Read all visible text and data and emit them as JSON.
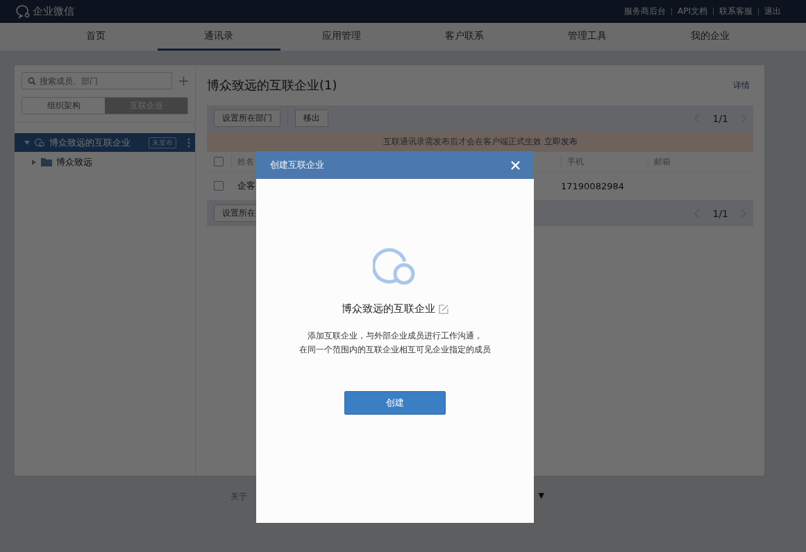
{
  "topbar": {
    "logo": "企业微信",
    "links": [
      "服务商后台",
      "API文档",
      "联系客服",
      "退出"
    ]
  },
  "nav": [
    {
      "label": "首页",
      "selected": false
    },
    {
      "label": "通讯录",
      "selected": true
    },
    {
      "label": "应用管理",
      "selected": false
    },
    {
      "label": "客户联系",
      "selected": false
    },
    {
      "label": "管理工具",
      "selected": false
    },
    {
      "label": "我的企业",
      "selected": false
    }
  ],
  "sidebar": {
    "search": {
      "placeholder": "搜索成员、部门"
    },
    "view_tabs": [
      {
        "label": "组织架构",
        "selected": false
      },
      {
        "label": "互联企业",
        "selected": true
      }
    ],
    "tree": [
      {
        "kind": "corp",
        "label": "博众致远的互联企业",
        "badge": "未发布",
        "selected": true,
        "expanded": true,
        "children": [
          {
            "kind": "folder",
            "label": "博众致远",
            "selected": false,
            "expanded": false
          }
        ]
      }
    ]
  },
  "main": {
    "title": "博众致远的互联企业(1)",
    "details_link": "详情",
    "toolbar_top": {
      "buttons": [
        "设置所在部门",
        "移出"
      ],
      "page": "1/1"
    },
    "notice": {
      "text": "互联通讯录需发布后才会在客户端正式生效",
      "link": "立即发布"
    },
    "table": {
      "header_checked": false,
      "columns": [
        "姓名",
        "手机",
        "邮箱"
      ],
      "rows": [
        {
          "checked": false,
          "name": "企客",
          "phone": "17190082984"
        }
      ]
    },
    "toolbar_bottom": {
      "buttons": [
        "设置所在"
      ],
      "page": "1/1"
    }
  },
  "footer": {
    "text": "关于",
    "caret": "▼"
  },
  "dialog": {
    "title": "创建互联企业",
    "name": "博众致远的互联企业",
    "description": [
      "添加互联企业，与外部企业成员进行工作沟通，",
      "在同一个范围内的互联企业相互可见企业指定的成员"
    ],
    "button": "创建"
  }
}
